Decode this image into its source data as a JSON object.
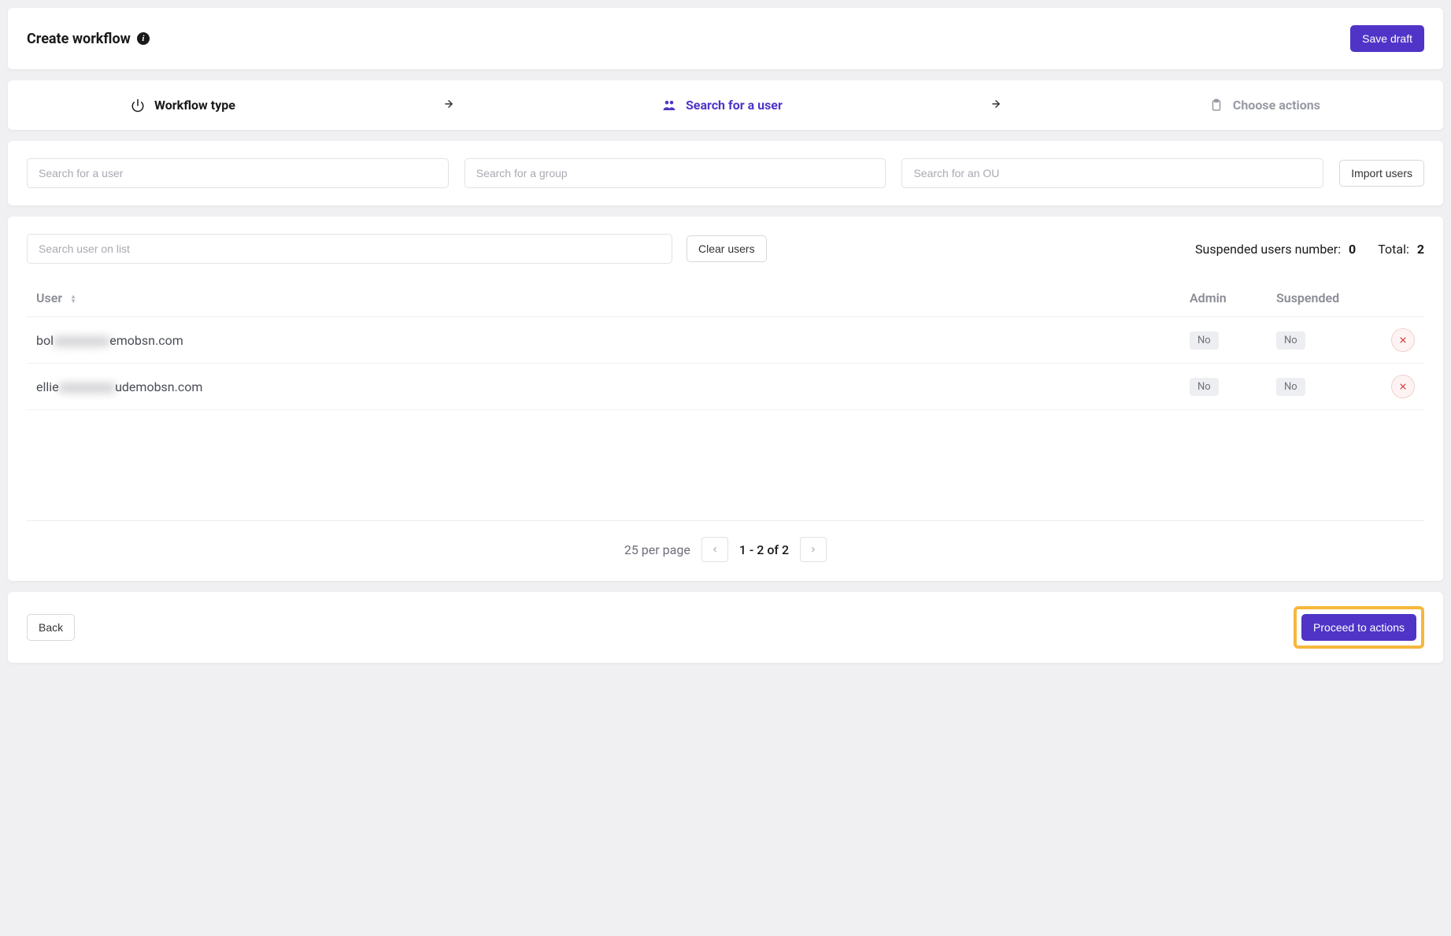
{
  "header": {
    "title": "Create workflow",
    "save_draft": "Save draft"
  },
  "steps": {
    "workflow_type": "Workflow type",
    "search_user": "Search for a user",
    "choose_actions": "Choose actions"
  },
  "search_row": {
    "user_placeholder": "Search for a user",
    "group_placeholder": "Search for a group",
    "ou_placeholder": "Search for an OU",
    "import_users": "Import users"
  },
  "users_panel": {
    "search_list_placeholder": "Search user on list",
    "clear_users": "Clear users",
    "suspended_label": "Suspended users number:",
    "suspended_value": "0",
    "total_label": "Total:",
    "total_value": "2",
    "columns": {
      "user": "User",
      "admin": "Admin",
      "suspended": "Suspended"
    },
    "rows": [
      {
        "email_prefix": "bol",
        "email_hidden": "xxxxxxxxx",
        "email_suffix": "emobsn.com",
        "admin": "No",
        "suspended": "No"
      },
      {
        "email_prefix": "ellie",
        "email_hidden": "xxxxxxxxx",
        "email_suffix": "udemobsn.com",
        "admin": "No",
        "suspended": "No"
      }
    ],
    "pagination": {
      "per_page": "25 per page",
      "range": "1 - 2 of 2"
    }
  },
  "footer": {
    "back": "Back",
    "proceed": "Proceed to actions"
  }
}
